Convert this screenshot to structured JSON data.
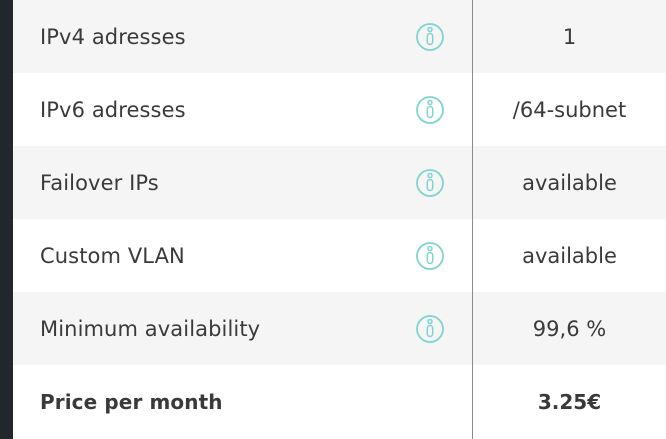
{
  "rows": [
    {
      "label": "IPv4 adresses",
      "value": "1",
      "info_icon": "info-icon"
    },
    {
      "label": "IPv6 adresses",
      "value": "/64-subnet",
      "info_icon": "info-icon"
    },
    {
      "label": "Failover IPs",
      "value": "available",
      "info_icon": "info-icon"
    },
    {
      "label": "Custom VLAN",
      "value": "available",
      "info_icon": "info-icon"
    },
    {
      "label": "Minimum availability",
      "value": "99,6 %",
      "info_icon": "info-icon"
    }
  ],
  "price": {
    "label": "Price per month",
    "value": "3.25€"
  },
  "colors": {
    "info_icon": "#7fd4d0",
    "text": "#3a3a3a",
    "row_alt": "#f5f5f5",
    "background": "#23272c"
  }
}
